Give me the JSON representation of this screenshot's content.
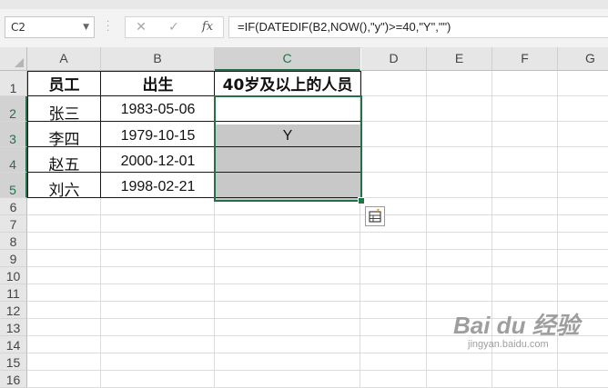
{
  "formula_bar": {
    "name_box": "C2",
    "cancel_icon": "✕",
    "enter_icon": "✓",
    "fx_label": "fx",
    "formula": "=IF(DATEDIF(B2,NOW(),\"y\")>=40,\"Y\",\"\")"
  },
  "columns": [
    "A",
    "B",
    "C",
    "D",
    "E",
    "F",
    "G"
  ],
  "rows": [
    "1",
    "2",
    "3",
    "4",
    "5",
    "6",
    "7",
    "8",
    "9",
    "10",
    "11",
    "12",
    "13",
    "14",
    "15",
    "16"
  ],
  "selected_cell": "C2",
  "selected_range": "C2:C5",
  "table": {
    "headers": [
      "员工",
      "出生",
      "40岁及以上的人员"
    ],
    "rows": [
      {
        "name": "张三",
        "birth": "1983-05-06",
        "flag": ""
      },
      {
        "name": "李四",
        "birth": "1979-10-15",
        "flag": "Y"
      },
      {
        "name": "赵五",
        "birth": "2000-12-01",
        "flag": ""
      },
      {
        "name": "刘六",
        "birth": "1998-02-21",
        "flag": ""
      }
    ]
  },
  "quick_analysis_icon": "quick-analysis-icon",
  "watermark": {
    "main": "Bai du 经验",
    "sub": "jingyan.baidu.com"
  },
  "colors": {
    "excel_green": "#217346",
    "cell_shade": "#c8c8c8",
    "header_bg": "#e6e6e6"
  }
}
